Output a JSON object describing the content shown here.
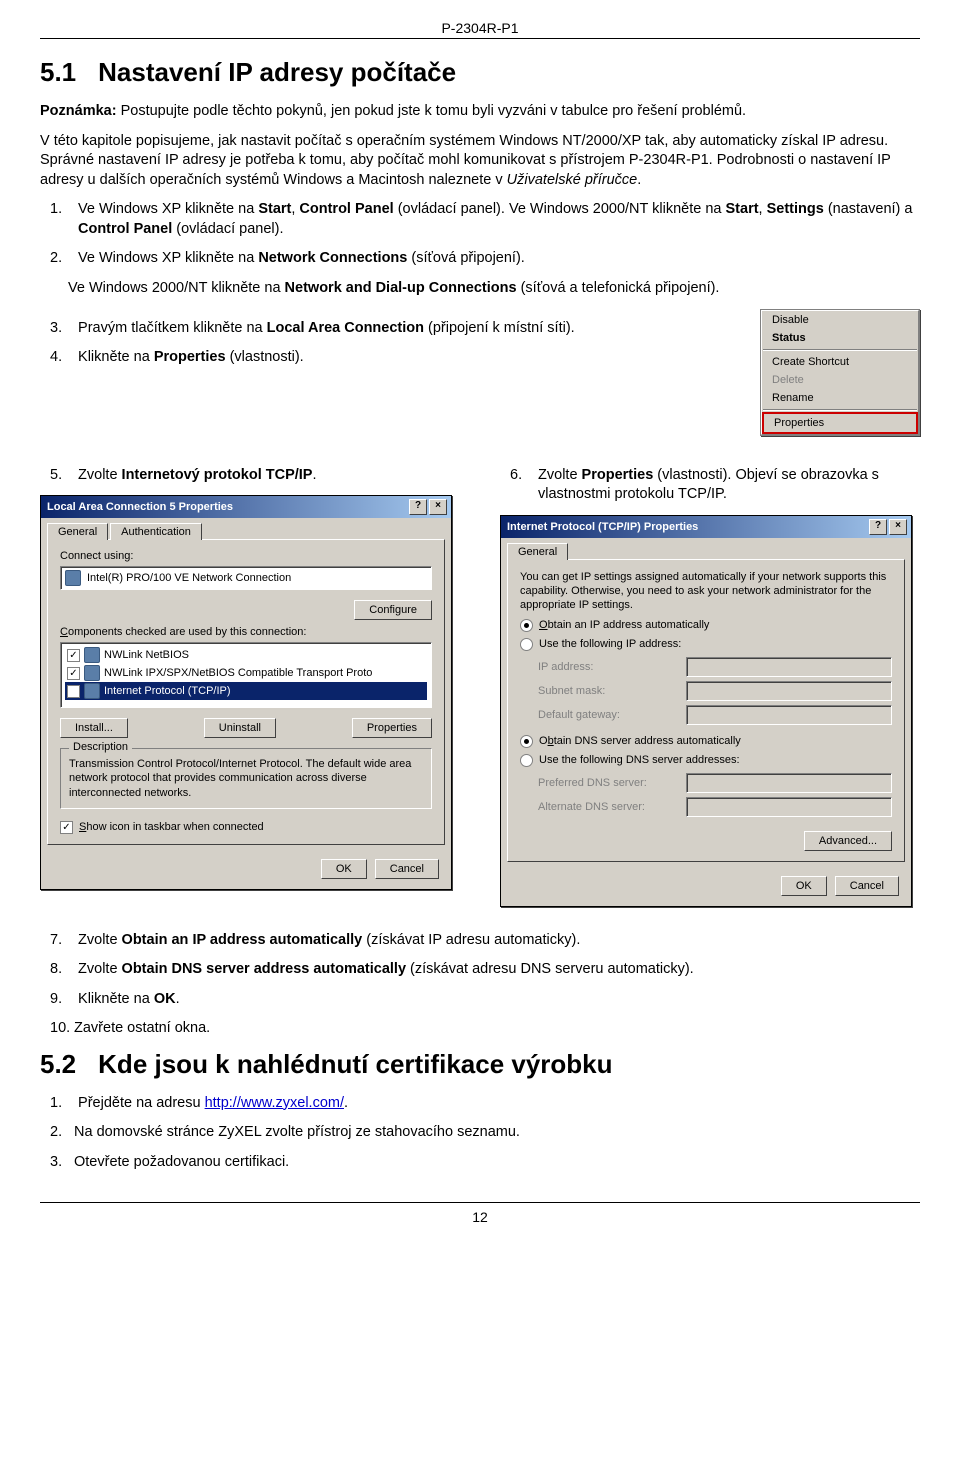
{
  "doc": {
    "header": "P-2304R-P1",
    "page_num": "12"
  },
  "section51": {
    "num": "5.1",
    "title": "Nastavení IP adresy počítače",
    "note_label": "Poznámka:",
    "note_text": " Postupujte podle těchto pokynů, jen pokud jste k tomu byli vyzváni v tabulce pro řešení problémů.",
    "p1a": "V této kapitole popisujeme, jak nastavit počítač s operačním systémem Windows NT/2000/XP tak, aby automaticky získal IP adresu. Správné nastavení IP adresy je potřeba k tomu, aby počítač mohl komunikovat s přístrojem P-2304R-P1. Podrobnosti o nastavení IP adresy u dalších operačních systémů Windows a Macintosh naleznete v ",
    "p1_em": "Uživatelské příručce",
    "p1b": ".",
    "step1a": "Ve Windows XP klikněte na ",
    "step1_b1": "Start",
    "step1b": ", ",
    "step1_b2": "Control Panel",
    "step1c": " (ovládací panel). Ve Windows 2000/NT klikněte na ",
    "step1_b3": "Start",
    "step1d": ", ",
    "step1_b4": "Settings",
    "step1e": " (nastavení) a ",
    "step1_b5": "Control Panel",
    "step1f": " (ovládací panel).",
    "step2a": "Ve Windows XP klikněte na ",
    "step2_b1": "Network Connections",
    "step2b": " (síťová připojení).",
    "step2c": "Ve Windows 2000/NT klikněte na ",
    "step2_b2": "Network and Dial-up Connections",
    "step2d": " (síťová a telefonická připojení).",
    "step3a": "Pravým tlačítkem klikněte na ",
    "step3_b1": "Local Area Connection",
    "step3b": " (připojení k místní síti).",
    "step4a": "Klikněte na ",
    "step4_b1": "Properties",
    "step4b": " (vlastnosti).",
    "step5a": "Zvolte ",
    "step5_b1": "Internetový protokol TCP/IP",
    "step5b": ".",
    "step6a": "Zvolte ",
    "step6_b1": "Properties",
    "step6b": " (vlastnosti). Objeví se obrazovka s vlastnostmi protokolu TCP/IP.",
    "step7a": "Zvolte ",
    "step7_b1": "Obtain an IP address automatically",
    "step7b": " (získávat IP adresu automaticky).",
    "step8a": "Zvolte ",
    "step8_b1": "Obtain DNS server address automatically",
    "step8b": " (získávat adresu DNS serveru automaticky).",
    "step9a": "Klikněte na ",
    "step9_b1": "OK",
    "step9b": ".",
    "step10": "Zavřete ostatní okna."
  },
  "ctx": {
    "disable": "Disable",
    "status": "Status",
    "create": "Create Shortcut",
    "delete": "Delete",
    "rename": "Rename",
    "properties": "Properties"
  },
  "dlg1": {
    "title": "Local Area Connection 5 Properties",
    "tab1": "General",
    "tab2": "Authentication",
    "connect_using": "Connect using:",
    "adapter": "Intel(R) PRO/100 VE Network Connection",
    "configure": "Configure",
    "components": "Components checked are used by this connection:",
    "c1": "NWLink NetBIOS",
    "c2": "NWLink IPX/SPX/NetBIOS Compatible Transport Proto",
    "c3": "Internet Protocol (TCP/IP)",
    "install": "Install...",
    "uninstall": "Uninstall",
    "properties": "Properties",
    "desc_lbl": "Description",
    "desc": "Transmission Control Protocol/Internet Protocol. The default wide area network protocol that provides communication across diverse interconnected networks.",
    "show_icon": "Show icon in taskbar when connected",
    "ok": "OK",
    "cancel": "Cancel"
  },
  "dlg2": {
    "title": "Internet Protocol (TCP/IP) Properties",
    "tab1": "General",
    "intro": "You can get IP settings assigned automatically if your network supports this capability. Otherwise, you need to ask your network administrator for the appropriate IP settings.",
    "r1": "Obtain an IP address automatically",
    "r2": "Use the following IP address:",
    "ip": "IP address:",
    "mask": "Subnet mask:",
    "gw": "Default gateway:",
    "r3": "Obtain DNS server address automatically",
    "r4": "Use the following DNS server addresses:",
    "pdns": "Preferred DNS server:",
    "adns": "Alternate DNS server:",
    "adv": "Advanced...",
    "ok": "OK",
    "cancel": "Cancel"
  },
  "section52": {
    "num": "5.2",
    "title": "Kde jsou k nahlédnutí certifikace výrobku",
    "s1a": "Přejděte na adresu ",
    "s1_link": "http://www.zyxel.com/",
    "s1b": ".",
    "s2": "Na domovské stránce ZyXEL zvolte přístroj ze stahovacího seznamu.",
    "s3": "Otevřete požadovanou certifikaci."
  }
}
